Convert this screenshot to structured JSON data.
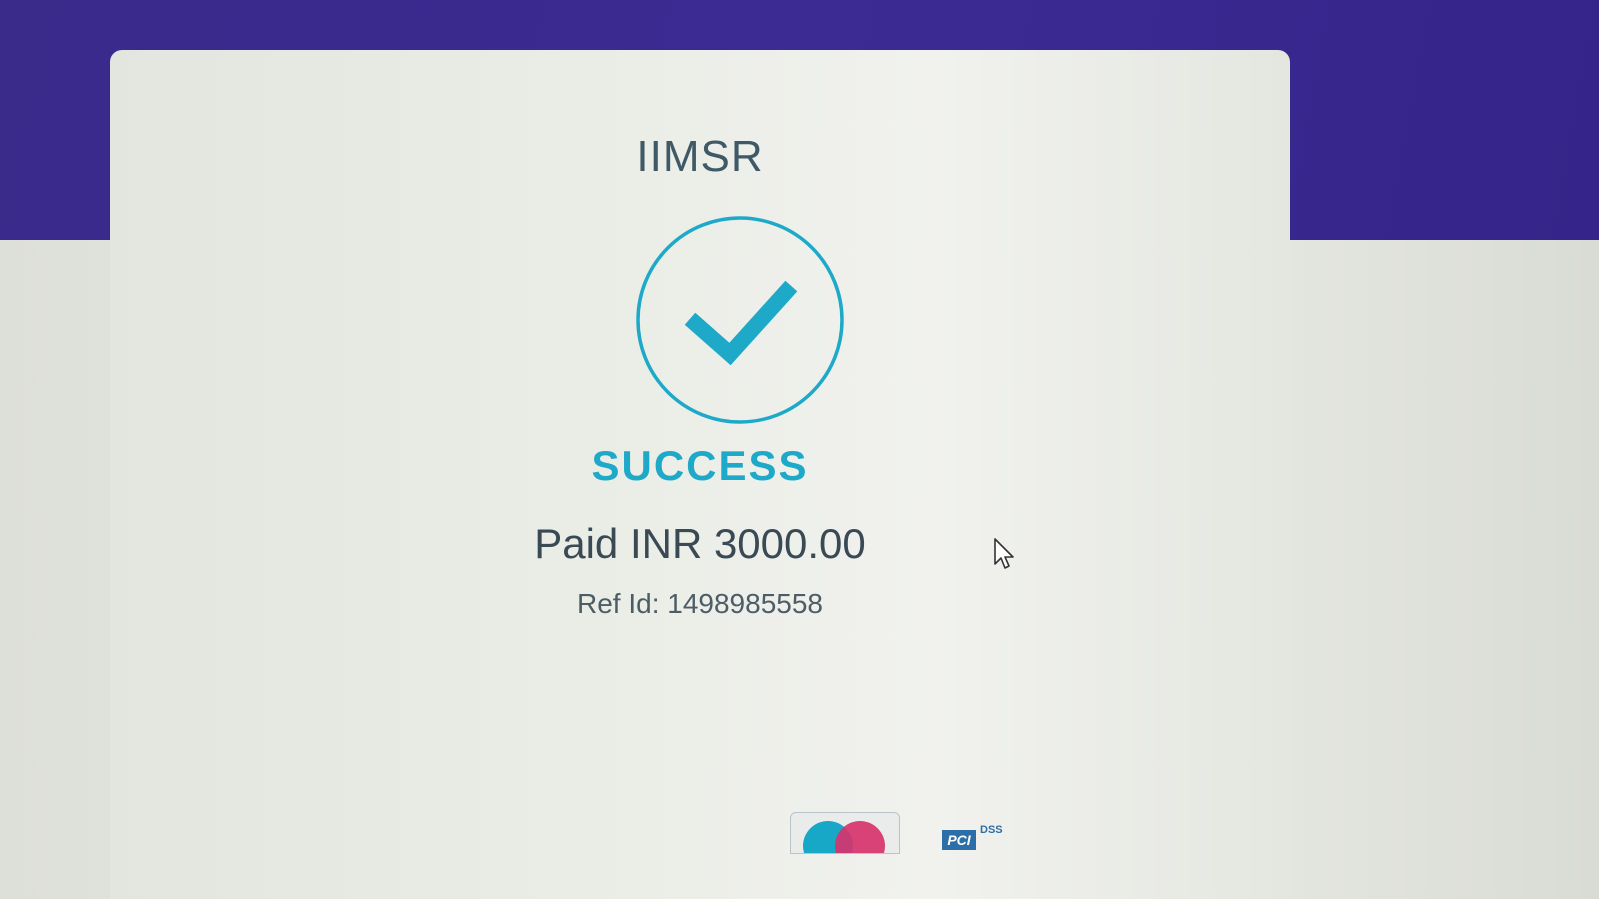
{
  "merchant": {
    "name": "IIMSR"
  },
  "payment": {
    "status": "SUCCESS",
    "amount_text": "Paid INR 3000.00",
    "reference_text": "Ref Id: 1498985558"
  },
  "badges": {
    "pci_short": "PCI",
    "pci_suffix": "DSS"
  },
  "icons": {
    "status": "check-circle-icon",
    "cursor": "mouse-pointer-icon",
    "card_network": "mastercard-logo",
    "compliance": "pci-dss-logo"
  },
  "colors": {
    "header_band": "#3b2b93",
    "accent": "#1fa9c9",
    "merchant_text": "#3f5a66",
    "amount_text": "#3a4a55"
  }
}
